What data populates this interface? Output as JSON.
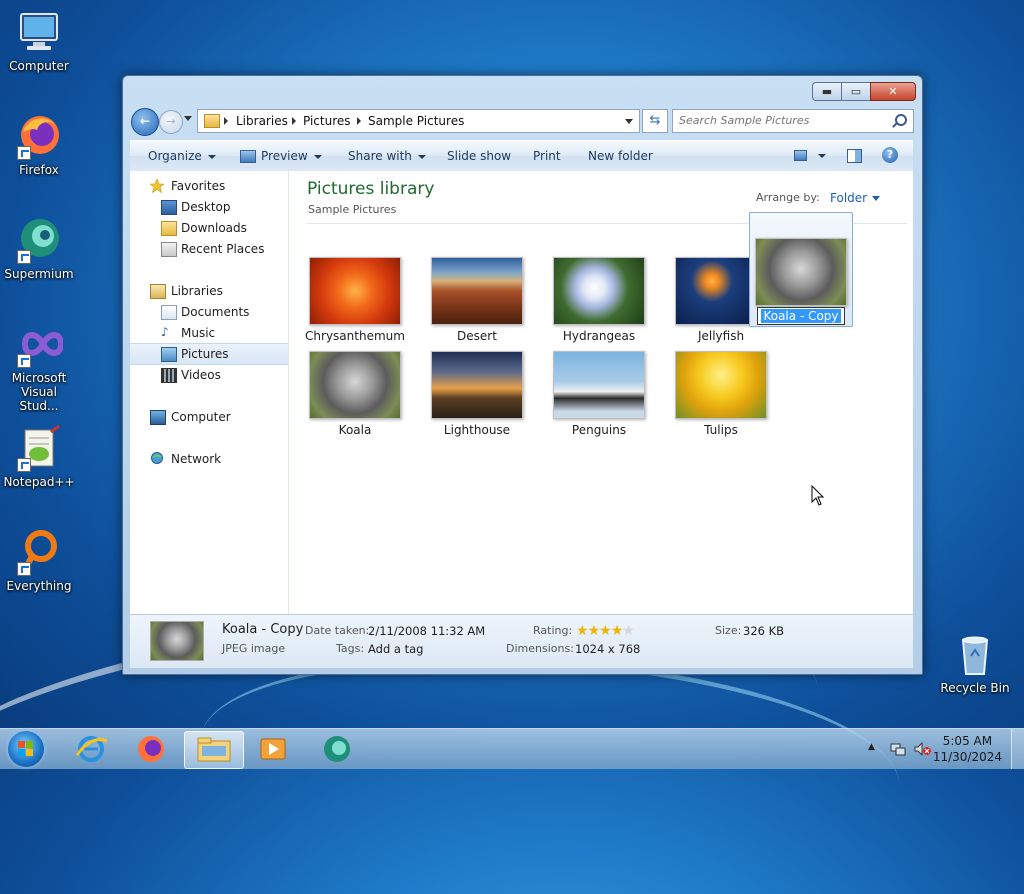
{
  "desktop": {
    "icons": [
      {
        "label": "Computer"
      },
      {
        "label": "Firefox"
      },
      {
        "label": "Supermium"
      },
      {
        "label": "Microsoft Visual Stud..."
      },
      {
        "label": "Notepad++"
      },
      {
        "label": "Everything"
      },
      {
        "label": "Recycle Bin"
      }
    ]
  },
  "window": {
    "caption": {
      "minimize": "▬",
      "maximize": "▭",
      "close": "✕"
    },
    "address": {
      "crumbs": [
        "Libraries",
        "Pictures",
        "Sample Pictures"
      ],
      "search_placeholder": "Search Sample Pictures"
    },
    "toolbar": {
      "organize": "Organize",
      "preview": "Preview",
      "share_with": "Share with",
      "slide_show": "Slide show",
      "print": "Print",
      "new_folder": "New folder",
      "help": "?"
    },
    "nav": {
      "favorites": "Favorites",
      "desktop": "Desktop",
      "downloads": "Downloads",
      "recent_places": "Recent Places",
      "libraries": "Libraries",
      "documents": "Documents",
      "music": "Music",
      "pictures": "Pictures",
      "videos": "Videos",
      "computer": "Computer",
      "network": "Network"
    },
    "content": {
      "title": "Pictures library",
      "subtitle": "Sample Pictures",
      "arrange_label": "Arrange by:",
      "arrange_value": "Folder",
      "files": [
        {
          "name": "Chrysanthemum"
        },
        {
          "name": "Desert"
        },
        {
          "name": "Hydrangeas"
        },
        {
          "name": "Jellyfish"
        },
        {
          "name": "Koala - Copy",
          "renaming": true
        },
        {
          "name": "Koala"
        },
        {
          "name": "Lighthouse"
        },
        {
          "name": "Penguins"
        },
        {
          "name": "Tulips"
        }
      ]
    },
    "details": {
      "name": "Koala - Copy",
      "type": "JPEG image",
      "date_taken_label": "Date taken:",
      "date_taken": "2/11/2008 11:32 AM",
      "tags_label": "Tags:",
      "tags": "Add a tag",
      "rating_label": "Rating:",
      "rating_stars": 4,
      "rating_max": 5,
      "dimensions_label": "Dimensions:",
      "dimensions": "1024 x 768",
      "size_label": "Size:",
      "size": "326 KB"
    }
  },
  "taskbar": {
    "time": "5:05 AM",
    "date": "11/30/2024"
  },
  "colors": {
    "library_title": "#1e6a2f",
    "link_blue": "#1e5fae",
    "selection": "#3399ff"
  }
}
